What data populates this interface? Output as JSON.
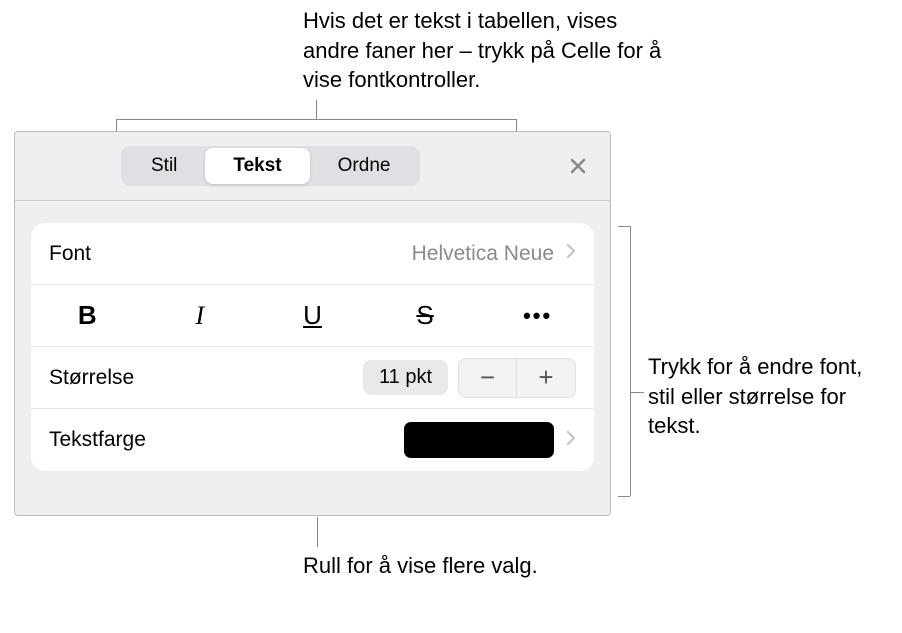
{
  "callouts": {
    "top": "Hvis det er tekst i tabellen, vises andre faner her – trykk på Celle for å vise fontkontroller.",
    "right": "Trykk for å endre font, stil eller størrelse for tekst.",
    "bottom": "Rull for å vise flere valg."
  },
  "tabs": {
    "style": "Stil",
    "text": "Tekst",
    "arrange": "Ordne"
  },
  "rows": {
    "font": {
      "label": "Font",
      "value": "Helvetica Neue"
    },
    "size": {
      "label": "Størrelse",
      "value": "11 pkt"
    },
    "textcolor": {
      "label": "Tekstfarge",
      "swatch": "#000000"
    }
  },
  "stylebuttons": {
    "bold": "B",
    "italic": "I",
    "underline": "U",
    "strike": "S",
    "more": "•••"
  },
  "stepper": {
    "minus": "−",
    "plus": "+"
  },
  "icons": {
    "close": "close",
    "chevron": "chevron"
  }
}
